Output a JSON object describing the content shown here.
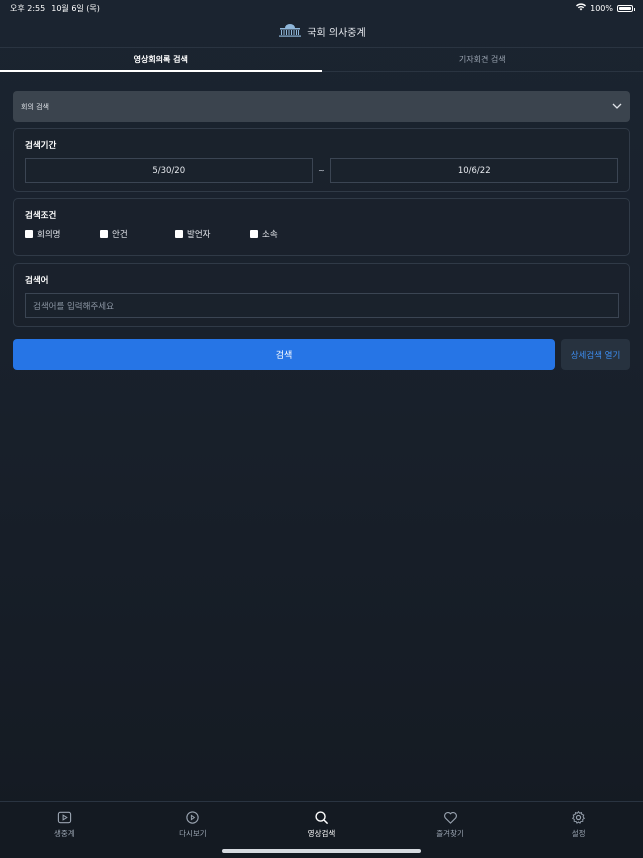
{
  "status_bar": {
    "time": "오후 2:55",
    "date": "10월 6일 (목)",
    "battery": "100%",
    "battery_level": 1.0
  },
  "header": {
    "title": "국회 의사중계"
  },
  "tabs": [
    {
      "label": "영상회의록 검색",
      "active": true
    },
    {
      "label": "기자회견 검색",
      "active": false
    }
  ],
  "meeting_select": {
    "value": "회의 검색"
  },
  "period": {
    "title": "검색기간",
    "start": "5/30/20",
    "separator": "~",
    "end": "10/6/22"
  },
  "conditions": {
    "title": "검색조건",
    "options": [
      {
        "label": "회의명",
        "checked": false
      },
      {
        "label": "안건",
        "checked": false
      },
      {
        "label": "발언자",
        "checked": false
      },
      {
        "label": "소속",
        "checked": false
      }
    ]
  },
  "keyword": {
    "title": "검색어",
    "placeholder": "검색어를 입력해주세요"
  },
  "buttons": {
    "search": "검색",
    "detail": "상세검색 열기"
  },
  "bottom_nav": [
    {
      "label": "생중계",
      "icon": "play-icon",
      "active": false
    },
    {
      "label": "다시보기",
      "icon": "replay-icon",
      "active": false
    },
    {
      "label": "영상검색",
      "icon": "search-icon",
      "active": true
    },
    {
      "label": "즐겨찾기",
      "icon": "heart-icon",
      "active": false
    },
    {
      "label": "설정",
      "icon": "gear-icon",
      "active": false
    }
  ],
  "colors": {
    "accent": "#2675e6",
    "detail_text": "#3d8df0",
    "background": "#19212c"
  }
}
